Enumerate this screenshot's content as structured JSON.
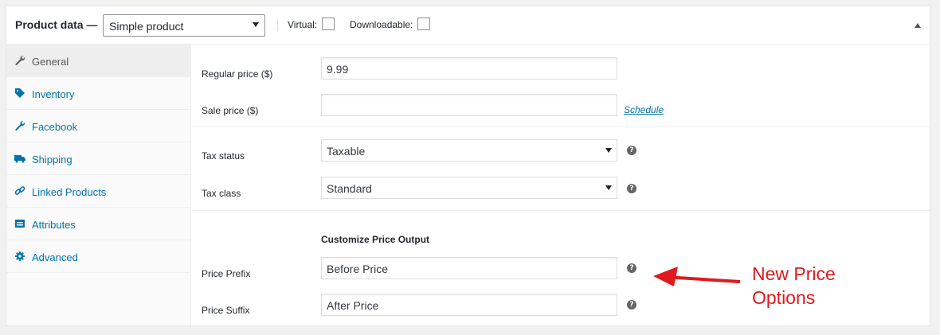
{
  "header": {
    "title": "Product data —",
    "product_type": "Simple product",
    "virtual_label": "Virtual:",
    "downloadable_label": "Downloadable:"
  },
  "sidebar": {
    "items": [
      {
        "label": "General",
        "icon": "wrench-icon",
        "active": true
      },
      {
        "label": "Inventory",
        "icon": "tag-icon",
        "active": false
      },
      {
        "label": "Facebook",
        "icon": "wrench-icon",
        "active": false
      },
      {
        "label": "Shipping",
        "icon": "truck-icon",
        "active": false
      },
      {
        "label": "Linked Products",
        "icon": "link-icon",
        "active": false
      },
      {
        "label": "Attributes",
        "icon": "list-icon",
        "active": false
      },
      {
        "label": "Advanced",
        "icon": "gear-icon",
        "active": false
      }
    ]
  },
  "pricing": {
    "regular_price_label": "Regular price ($)",
    "regular_price_value": "9.99",
    "sale_price_label": "Sale price ($)",
    "sale_price_value": "",
    "schedule_link": "Schedule"
  },
  "tax": {
    "status_label": "Tax status",
    "status_value": "Taxable",
    "class_label": "Tax class",
    "class_value": "Standard"
  },
  "price_output": {
    "heading": "Customize Price Output",
    "prefix_label": "Price Prefix",
    "prefix_value": "Before Price",
    "suffix_label": "Price Suffix",
    "suffix_value": "After Price"
  },
  "annotation": {
    "line1": "New Price",
    "line2": "Options",
    "color": "#e0191e"
  },
  "colors": {
    "link": "#0073aa",
    "active_bg": "#eeeeee"
  }
}
